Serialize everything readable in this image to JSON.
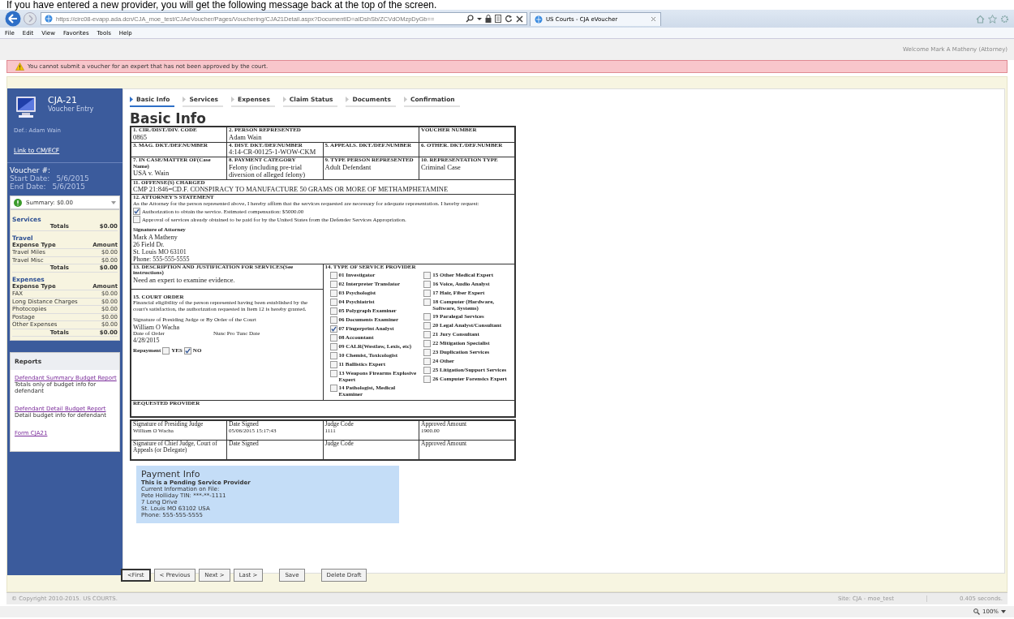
{
  "caption": "If you have entered a new provider, you will get the following message back at the top of the screen.",
  "browser": {
    "url": "https://circ08-evapp.ada.dcn/CJA_moe_test/CJAeVoucher/Pages/Vouchering/CJA21Detail.aspx?DocumentID=aIDshSb/ZCVdOMzpDyGb==",
    "tab_title": "US Courts - CJA eVoucher",
    "menu": [
      "File",
      "Edit",
      "View",
      "Favorites",
      "Tools",
      "Help"
    ]
  },
  "welcome": "Welcome Mark A Matheny (Attorney)",
  "error": "You cannot submit a voucher for an expert that has not been approved by the court.",
  "sidebar": {
    "title": "CJA-21",
    "subtitle": "Voucher Entry",
    "defendant": "Def.: Adam Wain",
    "link": "Link to CM/ECF",
    "voucher_label": "Voucher #:",
    "dates": [
      {
        "label": "Start Date:",
        "value": "5/6/2015"
      },
      {
        "label": "End Date:",
        "value": "5/6/2015"
      }
    ],
    "summary": "Summary: $0.00",
    "services": {
      "title": "Services",
      "totals_label": "Totals",
      "totals_value": "$0.00"
    },
    "groups": [
      {
        "title": "Travel",
        "columns": [
          "Expense Type",
          "Amount"
        ],
        "rows": [
          {
            "name": "Travel Miles",
            "amount": "$0.00"
          },
          {
            "name": "Travel Misc",
            "amount": "$0.00"
          }
        ],
        "totals_label": "Totals",
        "totals_value": "$0.00"
      },
      {
        "title": "Expenses",
        "columns": [
          "Expense Type",
          "Amount"
        ],
        "rows": [
          {
            "name": "FAX",
            "amount": "$0.00"
          },
          {
            "name": "Long Distance Charges",
            "amount": "$0.00"
          },
          {
            "name": "Photocopies",
            "amount": "$0.00"
          },
          {
            "name": "Postage",
            "amount": "$0.00"
          },
          {
            "name": "Other Expenses",
            "amount": "$0.00"
          }
        ],
        "totals_label": "Totals",
        "totals_value": "$0.00"
      }
    ],
    "reports": {
      "title": "Reports",
      "items": [
        {
          "link": "Defendant Summary Budget Report",
          "description": "Totals only of budget info for defendant"
        },
        {
          "link": "Defendant Detail Budget Report",
          "description": "Detail budget info for defendant"
        },
        {
          "link": "Form CJA21"
        }
      ]
    }
  },
  "tabs": [
    {
      "label": "Basic Info",
      "selected": true
    },
    {
      "label": "Services",
      "selected": false
    },
    {
      "label": "Expenses",
      "selected": false
    },
    {
      "label": "Claim Status",
      "selected": false
    },
    {
      "label": "Documents",
      "selected": false
    },
    {
      "label": "Confirmation",
      "selected": false
    }
  ],
  "form": {
    "heading": "Basic Info",
    "rows": [
      [
        {
          "label": "1. CIR./DIST./DIV. CODE",
          "value": "0865"
        },
        {
          "label": "2. PERSON REPRESENTED",
          "value": "Adam Wain",
          "colspan": 2
        },
        {
          "label": "VOUCHER NUMBER"
        }
      ],
      [
        {
          "label": "3. MAG. DKT./DEF.NUMBER"
        },
        {
          "label": "4. DIST. DKT./DEF.NUMBER",
          "value": "4:14-CR-00125-1-WOW-CKM"
        },
        {
          "label": "5. APPEALS. DKT./DEF.NUMBER"
        },
        {
          "label": "6. OTHER. DKT./DEF.NUMBER"
        }
      ],
      [
        {
          "label": "7. IN CASE/MATTER OF(Case Name)",
          "value": "USA v. Wain"
        },
        {
          "label": "8. PAYMENT CATEGORY",
          "value": "Felony (including pre-trial diversion of alleged felony)"
        },
        {
          "label": "9. TYPE PERSON REPRESENTED",
          "value": "Adult Defendant"
        },
        {
          "label": "10. REPRESENTATION TYPE",
          "value": "Criminal Case"
        }
      ],
      [
        {
          "label": "11. OFFENSE(S) CHARGED",
          "value": "CMP 21:846=CD.F. CONSPIRACY TO MANUFACTURE 50 GRAMS OR MORE OF METHAMPHETAMINE",
          "colspan": 4
        }
      ]
    ],
    "attorney_statement": {
      "label": "12. ATTORNEY'S STATEMENT",
      "text": "As the Attorney for the person represented above, I hereby affirm that the services requested are necessary for adequate representation. I hereby request:",
      "options": [
        {
          "label": "Authorization to obtain the service. Estimated compensation: $5000.00",
          "checked": true
        },
        {
          "label": "Approval of services already obtained to be paid for by the United States from the Defender Services Appropriation.",
          "checked": false
        }
      ],
      "signature_label": "Signature of Attorney",
      "signature_lines": [
        "Mark A Matheny",
        "26 Field Dr.",
        "St. Louis MO 63101",
        "Phone: 555-555-5555"
      ]
    },
    "description": {
      "label": "13. DESCRIPTION AND JUSTIFICATION FOR SERVICES(See instructions)",
      "value": "Need an expert to examine evidence."
    },
    "court_order": {
      "label": "15. COURT ORDER",
      "text": "Financial eligibility of the person represented having been established by the court's satisfaction, the authorization requested in Item 12 is hereby granted.",
      "signature_label": "Signature of Presiding Judge or By Order of the Court",
      "judge": "William O Wacha",
      "date_label": "Date of Order",
      "nunc_label": "Nunc Pro Tunc Date",
      "date": "4/28/2015",
      "repayment_label": "Repayment",
      "repayment": [
        {
          "label": "YES",
          "checked": false
        },
        {
          "label": "NO",
          "checked": true
        }
      ]
    },
    "service_providers": {
      "label": "14. TYPE OF SERVICE PROVIDER",
      "columns": [
        [
          {
            "label": "01 Investigator",
            "checked": false
          },
          {
            "label": "02 Interpreter Translator",
            "checked": false
          },
          {
            "label": "03 Psychologist",
            "checked": false
          },
          {
            "label": "04 Psychiatrist",
            "checked": false
          },
          {
            "label": "05 Polygraph Examiner",
            "checked": false
          },
          {
            "label": "06 Documents Examiner",
            "checked": false
          },
          {
            "label": "07 Fingerprint Analyst",
            "checked": true
          },
          {
            "label": "08 Accountant",
            "checked": false
          },
          {
            "label": "09 CALR(Westlaw, Lexis, etc)",
            "checked": false
          },
          {
            "label": "10 Chemist, Toxicologist",
            "checked": false
          },
          {
            "label": "11 Ballistics Expert",
            "checked": false
          },
          {
            "label": "13 Weapons Firearms Explosive Expert",
            "checked": false
          },
          {
            "label": "14 Pathologist, Medical Examiner",
            "checked": false
          }
        ],
        [
          {
            "label": "15 Other Medical Expert",
            "checked": false
          },
          {
            "label": "16 Voice, Audio Analyst",
            "checked": false
          },
          {
            "label": "17 Hair, Fiber Expert",
            "checked": false
          },
          {
            "label": "18 Computer (Hardware, Software, Systems)",
            "checked": false
          },
          {
            "label": "19 Paralegal Services",
            "checked": false
          },
          {
            "label": "20 Legal Analyst/Consultant",
            "checked": false
          },
          {
            "label": "21 Jury Consultant",
            "checked": false
          },
          {
            "label": "22 Mitigation Specialist",
            "checked": false
          },
          {
            "label": "23 Duplication Services",
            "checked": false
          },
          {
            "label": "24 Other",
            "checked": false
          },
          {
            "label": "25 Litigation/Support Services",
            "checked": false
          },
          {
            "label": "26 Computer Forensics Expert",
            "checked": false
          }
        ]
      ]
    },
    "requested_provider": {
      "label": "REQUESTED PROVIDER"
    },
    "approvals": [
      [
        {
          "label": "Signature of Presiding Judge",
          "value": "William O Wacha"
        },
        {
          "label": "Date Signed",
          "value": "05/06/2015 15:17:43"
        },
        {
          "label": "Judge Code",
          "value": "1111"
        },
        {
          "label": "Approved Amount",
          "value": "1900.00"
        }
      ],
      [
        {
          "label": "Signature of Chief Judge, Court of Appeals (or Delegate)"
        },
        {
          "label": "Date Signed"
        },
        {
          "label": "Judge Code"
        },
        {
          "label": "Approved Amount"
        }
      ]
    ]
  },
  "payment_info": {
    "title": "Payment Info",
    "status": "This is a Pending Service Provider",
    "lines": [
      "Current Information on File:",
      "Pete Holliday TIN: ***-**-1111",
      "7 Long Drive",
      "St. Louis MO 63102 USA",
      "Phone: 555-555-5555"
    ]
  },
  "buttons": [
    "<First",
    "< Previous",
    "Next >",
    "Last >",
    "Save",
    "Delete Draft"
  ],
  "footer": {
    "copyright": "© Copyright 2010-2015. US COURTS.",
    "site": "Site: CJA - moe_test",
    "timing": "0.405 seconds."
  },
  "status_bar": {
    "zoom": "100%"
  }
}
